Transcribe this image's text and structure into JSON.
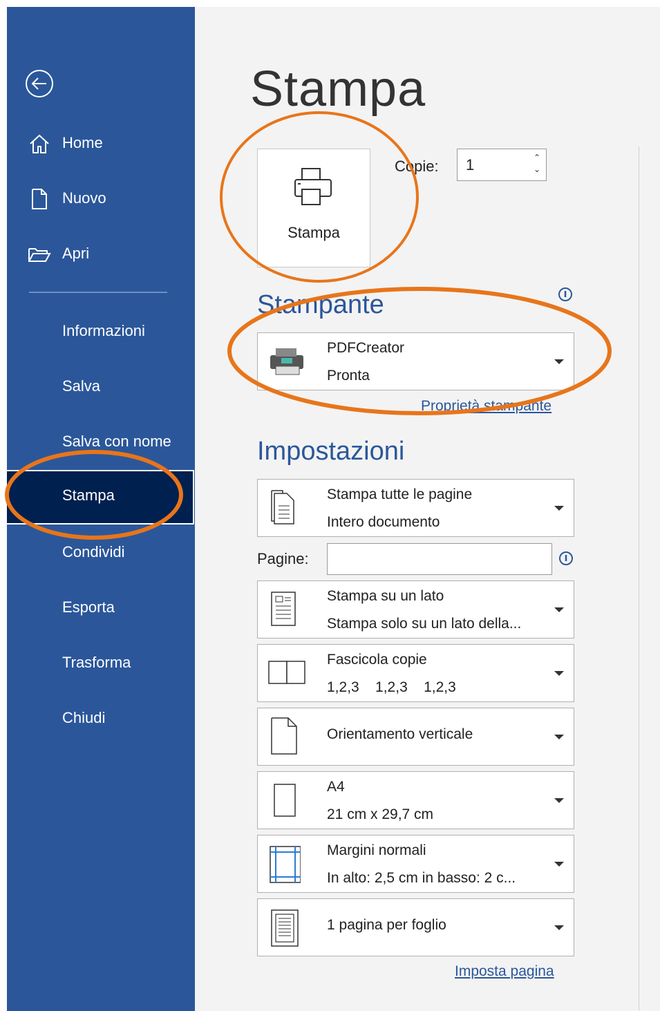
{
  "sidebar": {
    "items": [
      {
        "label": "Home",
        "icon": "home-icon"
      },
      {
        "label": "Nuovo",
        "icon": "new-document-icon"
      },
      {
        "label": "Apri",
        "icon": "folder-open-icon"
      },
      {
        "label": "Informazioni"
      },
      {
        "label": "Salva"
      },
      {
        "label": "Salva con nome"
      },
      {
        "label": "Stampa",
        "active": true
      },
      {
        "label": "Condividi"
      },
      {
        "label": "Esporta"
      },
      {
        "label": "Trasforma"
      },
      {
        "label": "Chiudi"
      }
    ]
  },
  "page_title": "Stampa",
  "print_button_label": "Stampa",
  "copies": {
    "label": "Copie:",
    "value": "1"
  },
  "printer": {
    "section_title": "Stampante",
    "name": "PDFCreator",
    "status": "Pronta",
    "properties_link": "Proprietà stampante"
  },
  "settings": {
    "section_title": "Impostazioni",
    "range": {
      "line1": "Stampa tutte le pagine",
      "line2": "Intero documento"
    },
    "pages_label": "Pagine:",
    "sides": {
      "line1": "Stampa su un lato",
      "line2": "Stampa solo su un lato della..."
    },
    "collate": {
      "line1": "Fascicola copie",
      "line2": "1,2,3    1,2,3    1,2,3"
    },
    "orientation": {
      "line1": "Orientamento verticale"
    },
    "paper": {
      "line1": "A4",
      "line2": "21 cm x 29,7 cm"
    },
    "margins": {
      "line1": "Margini normali",
      "line2": "In alto: 2,5 cm in basso: 2 c..."
    },
    "per_sheet": {
      "line1": "1 pagina per foglio"
    },
    "page_setup_link": "Imposta pagina"
  },
  "colors": {
    "sidebar": "#2b579a",
    "active": "#002050",
    "accent": "#2b579a",
    "annotation": "#e8751a"
  }
}
